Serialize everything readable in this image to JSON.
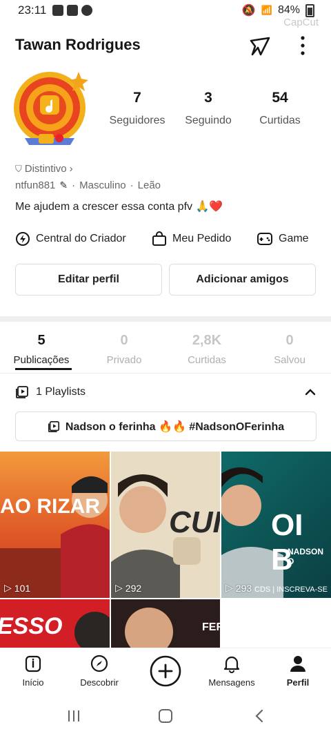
{
  "status": {
    "time": "23:11",
    "battery": "84%",
    "watermark": "CapCut"
  },
  "profile": {
    "name": "Tawan Rodrigues",
    "stats": [
      {
        "value": "7",
        "label": "Seguidores"
      },
      {
        "value": "3",
        "label": "Seguindo"
      },
      {
        "value": "54",
        "label": "Curtidas"
      }
    ],
    "badge": "Distintivo",
    "username": "ntfun881",
    "gender": "Masculino",
    "sign": "Leão",
    "bio": "Me ajudem a crescer essa conta pfv 🙏❤️"
  },
  "actions": {
    "creator": "Central do Criador",
    "order": "Meu Pedido",
    "game": "Game"
  },
  "buttons": {
    "edit": "Editar perfil",
    "add": "Adicionar amigos"
  },
  "tabs": [
    {
      "value": "5",
      "label": "Publicações"
    },
    {
      "value": "0",
      "label": "Privado"
    },
    {
      "value": "2,8K",
      "label": "Curtidas"
    },
    {
      "value": "0",
      "label": "Salvou"
    }
  ],
  "playlists": {
    "count_label": "1 Playlists",
    "item": "Nadson o ferinha 🔥🔥 #NadsonOFerinha"
  },
  "videos": [
    {
      "views": "101",
      "overlay": "AO RIZAR"
    },
    {
      "views": "292",
      "overlay": "CUID"
    },
    {
      "views": "293",
      "overlay": "OI B",
      "sub": "NADSON O",
      "caption": "CDS | INSCREVA-SE"
    },
    {
      "overlay": "ESSO"
    },
    {
      "overlay": "FER"
    }
  ],
  "nav": [
    "Início",
    "Descobrir",
    "Mensagens",
    "Perfil"
  ],
  "colors": {
    "accent": "#161616",
    "muted": "#b0b0b0",
    "heart": "#e8222c"
  }
}
